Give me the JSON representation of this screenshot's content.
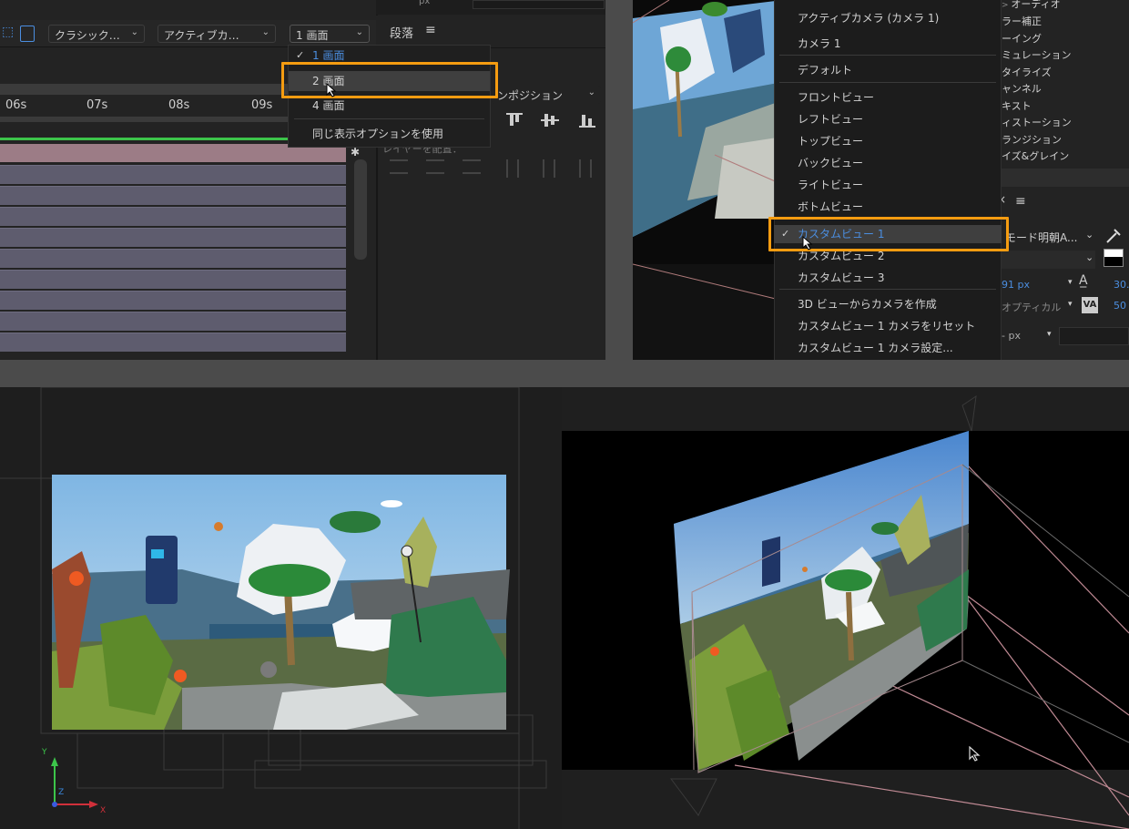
{
  "timeline": {
    "renderer_dropdown": "クラシック…",
    "camera_dropdown": "アクティブカ…",
    "layout_dropdown": "1 画面",
    "ticks": [
      "06s",
      "07s",
      "08s",
      "09s"
    ],
    "layout_menu": [
      {
        "label": "1 画面",
        "checked": true,
        "selected": false
      },
      {
        "label": "2 画面",
        "checked": false,
        "selected": true
      },
      {
        "label": "4 画面",
        "checked": false,
        "selected": false
      },
      {
        "label": "同じ表示オプションを使用",
        "checked": false,
        "selected": false
      }
    ]
  },
  "paragraph_panel": {
    "title": "段落",
    "field_placeholder": "px",
    "composition_dropdown": "ンポジション",
    "layer_label": "レイヤーを配置："
  },
  "view_menu": {
    "items": [
      {
        "label": "アクティブカメラ (カメラ 1)",
        "checked": false,
        "selected": false,
        "group": 1
      },
      {
        "label": "カメラ 1",
        "checked": false,
        "selected": false,
        "group": 1
      },
      {
        "label": "デフォルト",
        "checked": false,
        "selected": false,
        "group": 1
      },
      {
        "label": "フロントビュー",
        "checked": false,
        "selected": false,
        "group": 2
      },
      {
        "label": "レフトビュー",
        "checked": false,
        "selected": false,
        "group": 2
      },
      {
        "label": "トップビュー",
        "checked": false,
        "selected": false,
        "group": 2
      },
      {
        "label": "バックビュー",
        "checked": false,
        "selected": false,
        "group": 2
      },
      {
        "label": "ライトビュー",
        "checked": false,
        "selected": false,
        "group": 2
      },
      {
        "label": "ボトムビュー",
        "checked": false,
        "selected": false,
        "group": 2
      },
      {
        "label": "カスタムビュー 1",
        "checked": true,
        "selected": true,
        "group": 3
      },
      {
        "label": "カスタムビュー 2",
        "checked": false,
        "selected": false,
        "group": 3
      },
      {
        "label": "カスタムビュー 3",
        "checked": false,
        "selected": false,
        "group": 3
      },
      {
        "label": "3D ビューからカメラを作成",
        "checked": false,
        "selected": false,
        "group": 4
      },
      {
        "label": "カスタムビュー 1 カメラをリセット",
        "checked": false,
        "selected": false,
        "group": 4
      },
      {
        "label": "カスタムビュー 1 カメラ設定...",
        "checked": false,
        "selected": false,
        "group": 4
      }
    ]
  },
  "effects_list": [
    "オーディオ",
    "ラー補正",
    "ーイング",
    "ミュレーション",
    "タイライズ",
    "ャンネル",
    "キスト",
    "ィストーション",
    "ランジション",
    "イズ&グレイン"
  ],
  "character_panel": {
    "font_name": "モード明朝A...",
    "size_value": "91 px",
    "leading_value": "30.",
    "kerning_label": "オプティカル",
    "tracking_value": "50",
    "stroke_value": "- px"
  },
  "axis": {
    "y": "Y",
    "z": "Z",
    "x": "X"
  },
  "colors": {
    "accent_orange": "#f59c11",
    "selection_blue": "#4b8ee0",
    "layer_bar": "#5e5c6e",
    "pink_bar": "#9c7c86",
    "green_line": "#3cc44a"
  }
}
